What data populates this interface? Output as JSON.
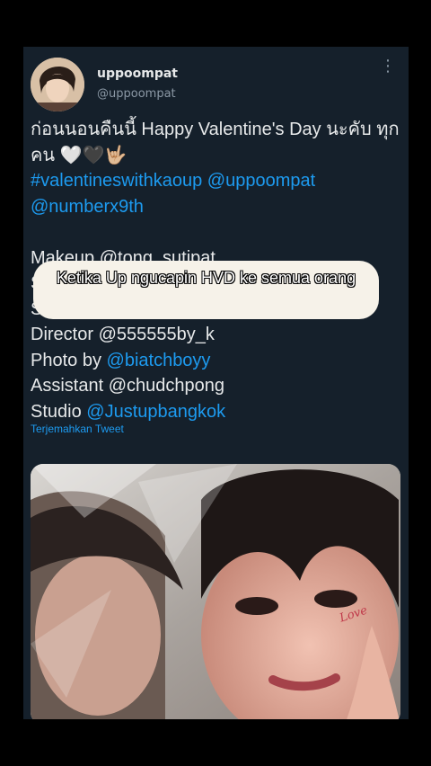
{
  "tweet": {
    "display_name": "uppoompat",
    "handle": "@uppoompat",
    "more_icon": "more-vertical-icon",
    "lines": [
      {
        "parts": [
          {
            "text": "ก่อนนอนคืนนี้ Happy Valentine's Day นะคับ ทุกคน 🤍🖤🤟🏼",
            "link": false
          }
        ]
      },
      {
        "parts": [
          {
            "text": "#valentineswithkaoup @uppoompat @numberx9th",
            "link": true
          }
        ]
      },
      {
        "parts": [
          {
            "text": "",
            "link": false
          }
        ]
      },
      {
        "parts": [
          {
            "text": "Makeup @tong_sutipat",
            "link": false
          }
        ]
      },
      {
        "parts": [
          {
            "text": "Stylist",
            "link": false
          }
        ]
      },
      {
        "parts": [
          {
            "text": "Styling",
            "link": false
          }
        ]
      },
      {
        "parts": [
          {
            "text": "Director @555555by_k",
            "link": false
          }
        ]
      },
      {
        "parts": [
          {
            "text": "Photo by ",
            "link": false
          },
          {
            "text": "@biatchboyy",
            "link": true
          }
        ]
      },
      {
        "parts": [
          {
            "text": "Assistant @chudchpong",
            "link": false
          }
        ]
      },
      {
        "parts": [
          {
            "text": "Studio ",
            "link": false
          },
          {
            "text": "@Justupbangkok",
            "link": true
          }
        ]
      }
    ],
    "translate_label": "Terjemahkan Tweet",
    "image_text": "Love"
  },
  "overlay": {
    "caption": "Ketika Up ngucapin HVD ke semua orang"
  },
  "colors": {
    "background": "#000000",
    "card": "#15202b",
    "text": "#e7e9ea",
    "muted": "#8b98a5",
    "link": "#1d9bf0"
  }
}
